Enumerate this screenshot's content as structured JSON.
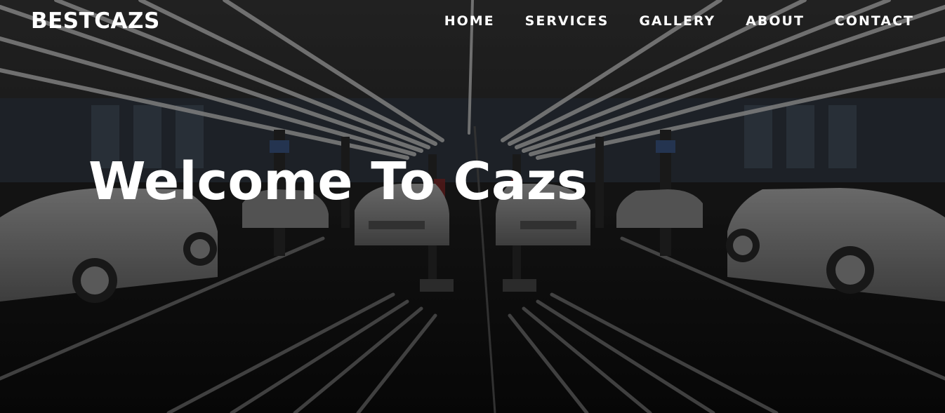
{
  "brand": {
    "name": "BESTCAZS"
  },
  "nav": {
    "items": [
      {
        "label": "HOME"
      },
      {
        "label": "SERVICES"
      },
      {
        "label": "GALLERY"
      },
      {
        "label": "ABOUT"
      },
      {
        "label": "CONTACT"
      }
    ]
  },
  "hero": {
    "title": "Welcome To Cazs",
    "background_image": "car-showroom-photo"
  },
  "colors": {
    "text": "#ffffff",
    "overlay": "#000000",
    "floor": "#0c0c0c",
    "ceiling_light": "#d9d9d9",
    "car_body": "#8d8d8d"
  }
}
